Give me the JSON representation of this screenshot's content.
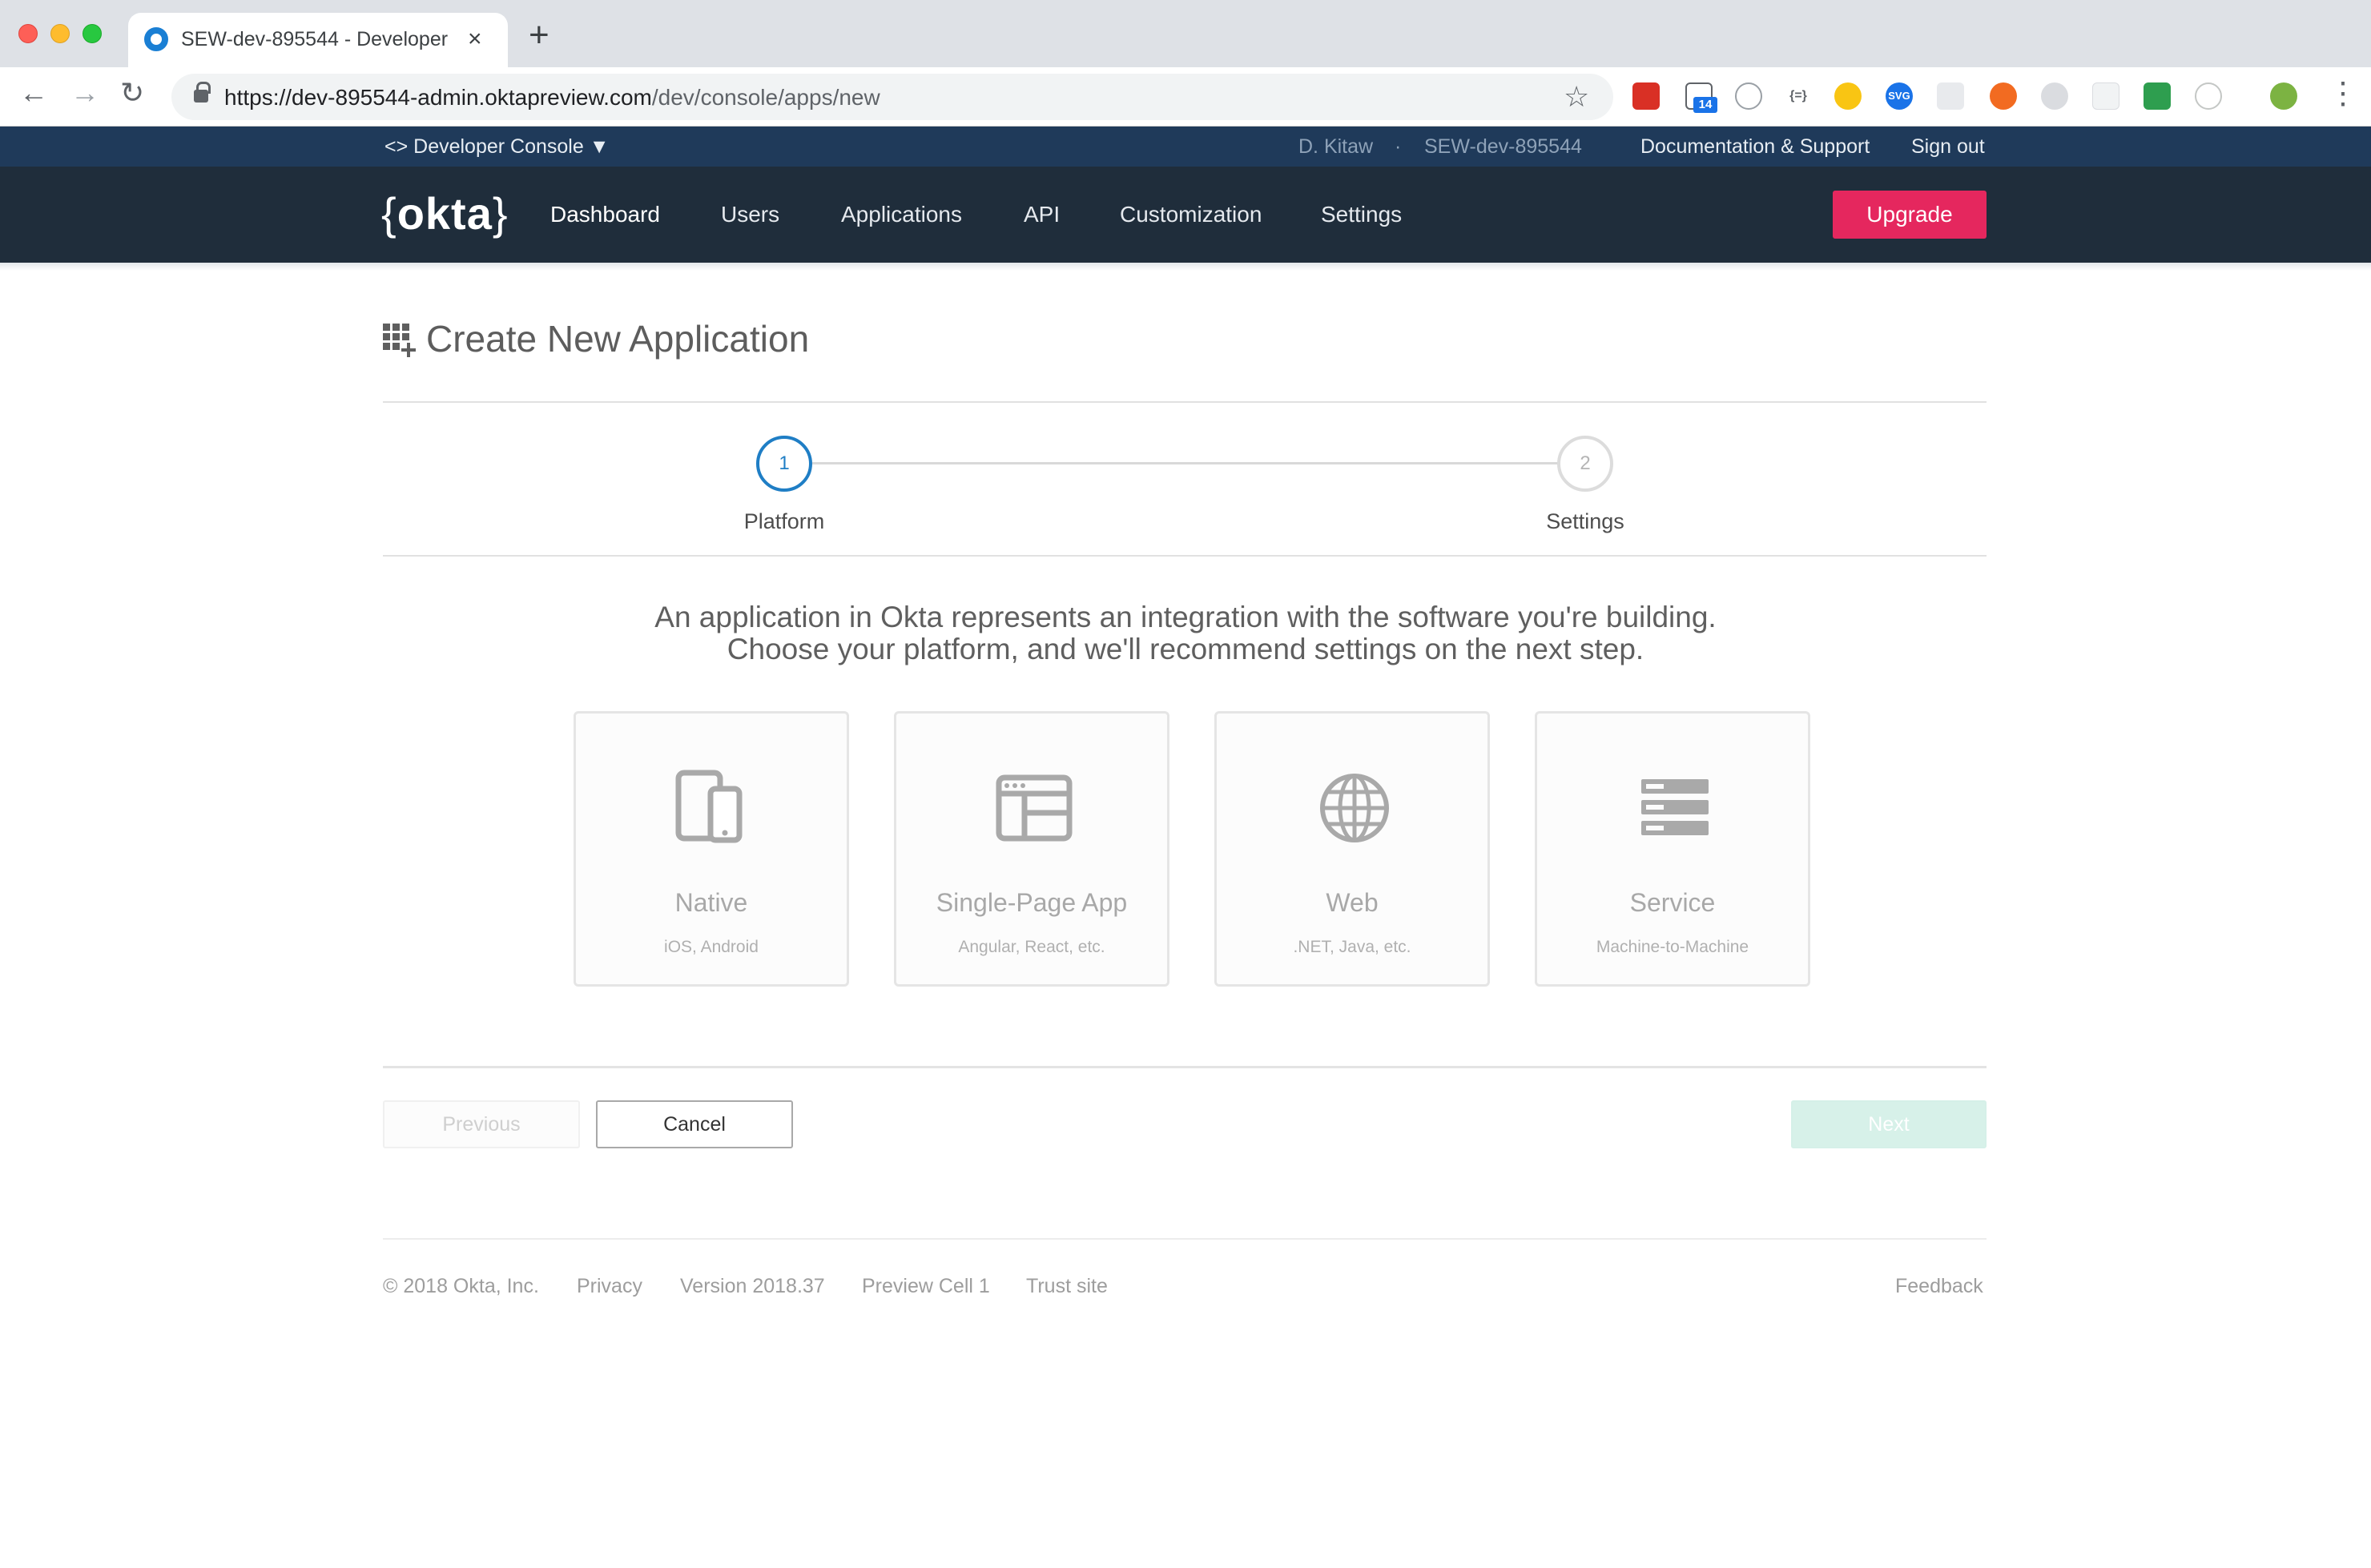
{
  "browser": {
    "tab_title": "SEW-dev-895544 - Developer",
    "tab_close": "×",
    "new_tab": "+",
    "url_host": "https://dev-895544-admin.oktapreview.com",
    "url_path": "/dev/console/apps/new",
    "back": "←",
    "forward": "→",
    "reload": "↻",
    "star": "☆",
    "menu": "⋮",
    "extension_badge": "14"
  },
  "topbar": {
    "console_label": "<> Developer Console ▼",
    "user": "D. Kitaw",
    "separator": "·",
    "org": "SEW-dev-895544",
    "docs": "Documentation & Support",
    "signout": "Sign out"
  },
  "navbar": {
    "logo_text": "okta",
    "brace_open": "{",
    "brace_close": "}",
    "items": [
      "Dashboard",
      "Users",
      "Applications",
      "API",
      "Customization",
      "Settings"
    ],
    "upgrade": "Upgrade",
    "upgrade_color": "#e5275e"
  },
  "page": {
    "title": "Create New Application",
    "title_icon": "apps-add-icon"
  },
  "wizard": {
    "steps": [
      {
        "number": "1",
        "label": "Platform",
        "state": "active"
      },
      {
        "number": "2",
        "label": "Settings",
        "state": "inactive"
      }
    ],
    "active_color": "#1f7ec5"
  },
  "intro": {
    "line1": "An application in Okta represents an integration with the software you're building.",
    "line2": "Choose your platform, and we'll recommend settings on the next step."
  },
  "platforms": [
    {
      "name": "Native",
      "sub": "iOS, Android",
      "icon": "mobile-devices-icon"
    },
    {
      "name": "Single-Page App",
      "sub": "Angular, React, etc.",
      "icon": "browser-window-icon"
    },
    {
      "name": "Web",
      "sub": ".NET, Java, etc.",
      "icon": "globe-icon"
    },
    {
      "name": "Service",
      "sub": "Machine-to-Machine",
      "icon": "server-stack-icon"
    }
  ],
  "actions": {
    "previous": "Previous",
    "cancel": "Cancel",
    "next": "Next"
  },
  "footer": {
    "copyright": "© 2018 Okta, Inc.",
    "privacy": "Privacy",
    "version": "Version 2018.37",
    "cell": "Preview Cell 1",
    "trust": "Trust site",
    "feedback": "Feedback"
  }
}
